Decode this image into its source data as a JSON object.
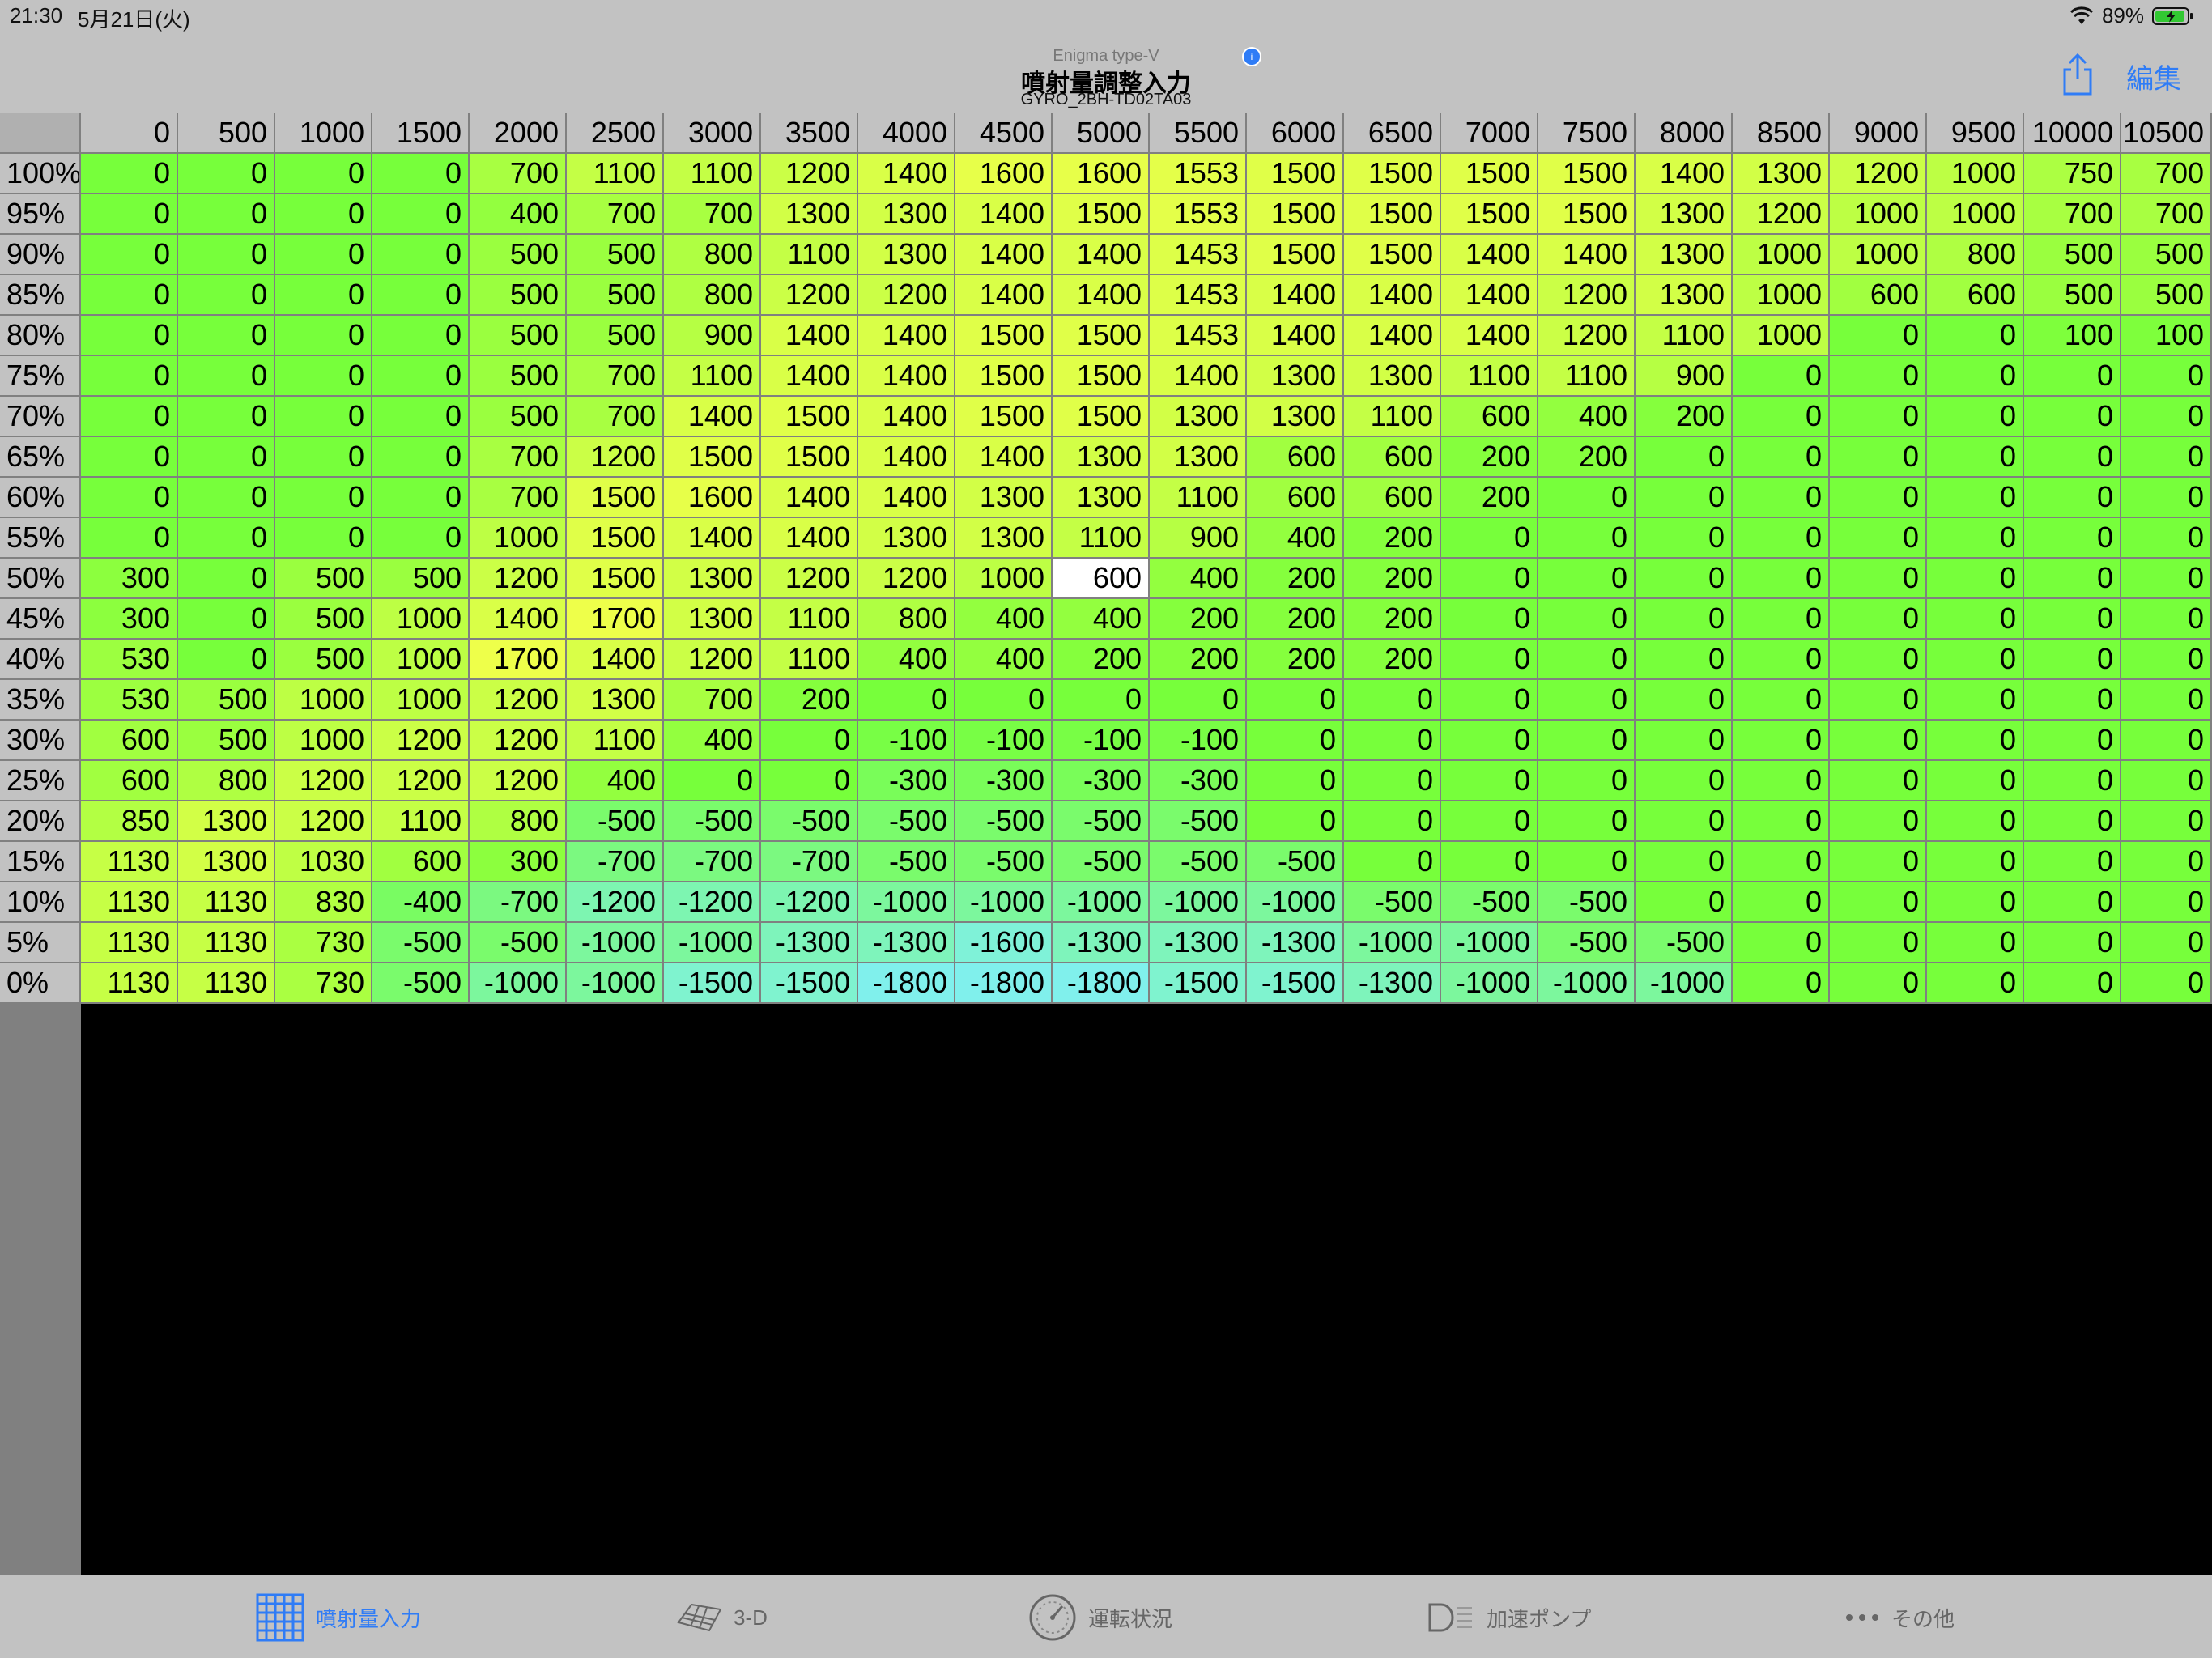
{
  "status_bar": {
    "time": "21:30",
    "date": "5月21日(火)",
    "battery_percent": "89%"
  },
  "nav": {
    "app_subtitle": "Enigma type-V",
    "title": "噴射量調整入力",
    "model": "GYRO_2BH-TD02TA03",
    "edit_label": "編集",
    "badge_icon": "info-icon",
    "share_icon": "share-icon"
  },
  "table": {
    "columns": [
      "0",
      "500",
      "1000",
      "1500",
      "2000",
      "2500",
      "3000",
      "3500",
      "4000",
      "4500",
      "5000",
      "5500",
      "6000",
      "6500",
      "7000",
      "7500",
      "8000",
      "8500",
      "9000",
      "9500",
      "10000",
      "10500"
    ],
    "rows": [
      {
        "label": "100%",
        "values": [
          0,
          0,
          0,
          0,
          700,
          1100,
          1100,
          1200,
          1400,
          1600,
          1600,
          1553,
          1500,
          1500,
          1500,
          1500,
          1400,
          1300,
          1200,
          1000,
          750,
          700
        ]
      },
      {
        "label": "95%",
        "values": [
          0,
          0,
          0,
          0,
          400,
          700,
          700,
          1300,
          1300,
          1400,
          1500,
          1553,
          1500,
          1500,
          1500,
          1500,
          1300,
          1200,
          1000,
          1000,
          700,
          700
        ]
      },
      {
        "label": "90%",
        "values": [
          0,
          0,
          0,
          0,
          500,
          500,
          800,
          1100,
          1300,
          1400,
          1400,
          1453,
          1500,
          1500,
          1400,
          1400,
          1300,
          1000,
          1000,
          800,
          500,
          500
        ]
      },
      {
        "label": "85%",
        "values": [
          0,
          0,
          0,
          0,
          500,
          500,
          800,
          1200,
          1200,
          1400,
          1400,
          1453,
          1400,
          1400,
          1400,
          1200,
          1300,
          1000,
          600,
          600,
          500,
          500
        ]
      },
      {
        "label": "80%",
        "values": [
          0,
          0,
          0,
          0,
          500,
          500,
          900,
          1400,
          1400,
          1500,
          1500,
          1453,
          1400,
          1400,
          1400,
          1200,
          1100,
          1000,
          0,
          0,
          100,
          100
        ]
      },
      {
        "label": "75%",
        "values": [
          0,
          0,
          0,
          0,
          500,
          700,
          1100,
          1400,
          1400,
          1500,
          1500,
          1400,
          1300,
          1300,
          1100,
          1100,
          900,
          0,
          0,
          0,
          0,
          0
        ]
      },
      {
        "label": "70%",
        "values": [
          0,
          0,
          0,
          0,
          500,
          700,
          1400,
          1500,
          1400,
          1500,
          1500,
          1300,
          1300,
          1100,
          600,
          400,
          200,
          0,
          0,
          0,
          0,
          0
        ]
      },
      {
        "label": "65%",
        "values": [
          0,
          0,
          0,
          0,
          700,
          1200,
          1500,
          1500,
          1400,
          1400,
          1300,
          1300,
          600,
          600,
          200,
          200,
          0,
          0,
          0,
          0,
          0,
          0
        ]
      },
      {
        "label": "60%",
        "values": [
          0,
          0,
          0,
          0,
          700,
          1500,
          1600,
          1400,
          1400,
          1300,
          1300,
          1100,
          600,
          600,
          200,
          0,
          0,
          0,
          0,
          0,
          0,
          0
        ]
      },
      {
        "label": "55%",
        "values": [
          0,
          0,
          0,
          0,
          1000,
          1500,
          1400,
          1400,
          1300,
          1300,
          1100,
          900,
          400,
          200,
          0,
          0,
          0,
          0,
          0,
          0,
          0,
          0
        ]
      },
      {
        "label": "50%",
        "values": [
          300,
          0,
          500,
          500,
          1200,
          1500,
          1300,
          1200,
          1200,
          1000,
          600,
          400,
          200,
          200,
          0,
          0,
          0,
          0,
          0,
          0,
          0,
          0
        ]
      },
      {
        "label": "45%",
        "values": [
          300,
          0,
          500,
          1000,
          1400,
          1700,
          1300,
          1100,
          800,
          400,
          400,
          200,
          200,
          200,
          0,
          0,
          0,
          0,
          0,
          0,
          0,
          0
        ]
      },
      {
        "label": "40%",
        "values": [
          530,
          0,
          500,
          1000,
          1700,
          1400,
          1200,
          1100,
          400,
          400,
          200,
          200,
          200,
          200,
          0,
          0,
          0,
          0,
          0,
          0,
          0,
          0
        ]
      },
      {
        "label": "35%",
        "values": [
          530,
          500,
          1000,
          1000,
          1200,
          1300,
          700,
          200,
          0,
          0,
          0,
          0,
          0,
          0,
          0,
          0,
          0,
          0,
          0,
          0,
          0,
          0
        ]
      },
      {
        "label": "30%",
        "values": [
          600,
          500,
          1000,
          1200,
          1200,
          1100,
          400,
          0,
          -100,
          -100,
          -100,
          -100,
          0,
          0,
          0,
          0,
          0,
          0,
          0,
          0,
          0,
          0
        ]
      },
      {
        "label": "25%",
        "values": [
          600,
          800,
          1200,
          1200,
          1200,
          400,
          0,
          0,
          -300,
          -300,
          -300,
          -300,
          0,
          0,
          0,
          0,
          0,
          0,
          0,
          0,
          0,
          0
        ]
      },
      {
        "label": "20%",
        "values": [
          850,
          1300,
          1200,
          1100,
          800,
          -500,
          -500,
          -500,
          -500,
          -500,
          -500,
          -500,
          0,
          0,
          0,
          0,
          0,
          0,
          0,
          0,
          0,
          0
        ]
      },
      {
        "label": "15%",
        "values": [
          1130,
          1300,
          1030,
          600,
          300,
          -700,
          -700,
          -700,
          -500,
          -500,
          -500,
          -500,
          -500,
          0,
          0,
          0,
          0,
          0,
          0,
          0,
          0,
          0
        ]
      },
      {
        "label": "10%",
        "values": [
          1130,
          1130,
          830,
          -400,
          -700,
          -1200,
          -1200,
          -1200,
          -1000,
          -1000,
          -1000,
          -1000,
          -1000,
          -500,
          -500,
          -500,
          0,
          0,
          0,
          0,
          0,
          0
        ]
      },
      {
        "label": "5%",
        "values": [
          1130,
          1130,
          730,
          -500,
          -500,
          -1000,
          -1000,
          -1300,
          -1300,
          -1600,
          -1300,
          -1300,
          -1300,
          -1000,
          -1000,
          -500,
          -500,
          0,
          0,
          0,
          0,
          0
        ]
      },
      {
        "label": "0%",
        "values": [
          1130,
          1130,
          730,
          -500,
          -1000,
          -1000,
          -1500,
          -1500,
          -1800,
          -1800,
          -1800,
          -1500,
          -1500,
          -1300,
          -1000,
          -1000,
          -1000,
          0,
          0,
          0,
          0,
          0
        ]
      }
    ],
    "selected_cell": {
      "row": 10,
      "col": 10
    },
    "colors": {
      "grid_line": "#808080",
      "header_bg": "#c2c2c2",
      "selected_bg": "#ffffff"
    }
  },
  "tabs": [
    {
      "label": "噴射量入力",
      "icon": "grid-icon",
      "active": true
    },
    {
      "label": "3-D",
      "icon": "surface-3d-icon",
      "active": false
    },
    {
      "label": "運転状況",
      "icon": "gauge-icon",
      "active": false
    },
    {
      "label": "加速ポンプ",
      "icon": "headlight-icon",
      "active": false
    },
    {
      "label": "その他",
      "icon": "more-icon",
      "active": false
    }
  ],
  "accent_color": "#2f7cf6"
}
